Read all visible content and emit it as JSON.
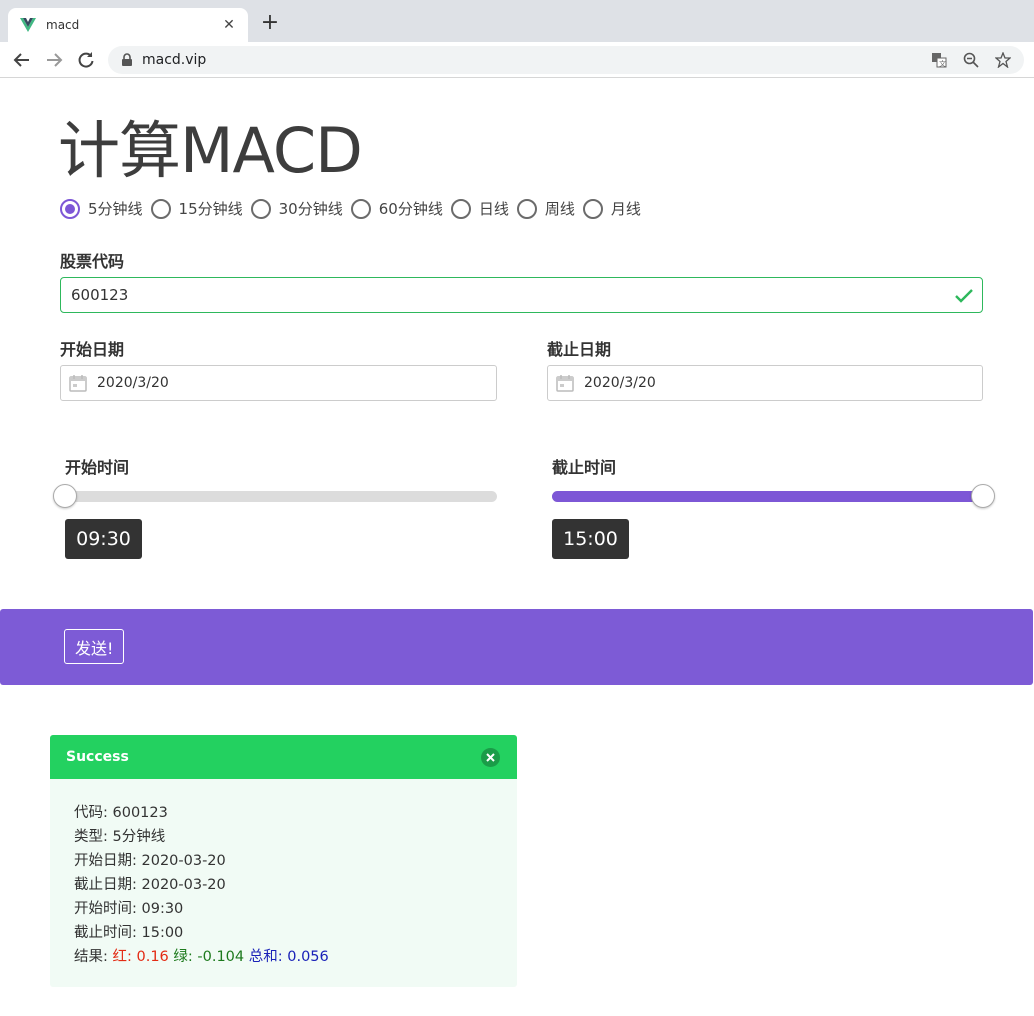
{
  "browser": {
    "tab_title": "macd",
    "url": "macd.vip"
  },
  "page": {
    "title": "计算MACD",
    "kline_types": [
      {
        "label": "5分钟线",
        "checked": true
      },
      {
        "label": "15分钟线",
        "checked": false
      },
      {
        "label": "30分钟线",
        "checked": false
      },
      {
        "label": "60分钟线",
        "checked": false
      },
      {
        "label": "日线",
        "checked": false
      },
      {
        "label": "周线",
        "checked": false
      },
      {
        "label": "月线",
        "checked": false
      }
    ],
    "stock_code_label": "股票代码",
    "stock_code_value": "600123",
    "start_date_label": "开始日期",
    "start_date_value": "2020/3/20",
    "end_date_label": "截止日期",
    "end_date_value": "2020/3/20",
    "start_time_label": "开始时间",
    "start_time_value": "09:30",
    "start_time_fraction": 0,
    "end_time_label": "截止时间",
    "end_time_value": "15:00",
    "end_time_fraction": 1,
    "submit_label": "发送!",
    "accent_color": "#7d57d6"
  },
  "alert": {
    "header": "Success",
    "color": "#23d160",
    "lines": {
      "code": "代码: 600123",
      "type": "类型: 5分钟线",
      "start_date": "开始日期: 2020-03-20",
      "end_date": "截止日期: 2020-03-20",
      "start_time": "开始时间: 09:30",
      "end_time": "截止时间: 15:00"
    },
    "result": {
      "prefix": "结果: ",
      "red_label": "红: 0.16",
      "green_label": "绿: -0.104",
      "sum_label": "总和: 0.056"
    }
  }
}
